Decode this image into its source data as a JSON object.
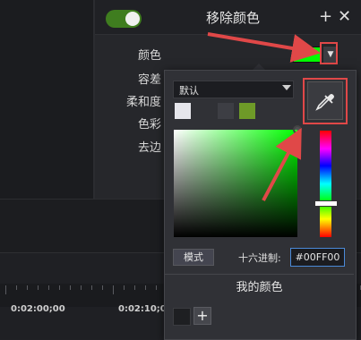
{
  "header": {
    "title": "移除颜色",
    "add_symbol": "+",
    "close_symbol": "✕"
  },
  "properties": {
    "color_label": "颜色",
    "tolerance_label": "容差",
    "softness_label": "柔和度",
    "hue_label": "色彩",
    "defringe_label": "去边",
    "selected_color": "#00ff00",
    "effect_enabled": true
  },
  "color_picker": {
    "preset": "默认",
    "recent_colors": [
      "#e6e6ec",
      "#3d3e44",
      "#6e9a28"
    ],
    "mode_label": "模式",
    "hex_label": "十六进制:",
    "hex_value": "#00FF00",
    "my_colors_title": "我的颜色",
    "my_colors": [
      "#1e1f22"
    ],
    "add_color_symbol": "+"
  },
  "timeline": {
    "time_labels": [
      "0:02:00;00",
      "0:02:10;00"
    ]
  },
  "colors": {
    "accent_red": "#e04848",
    "toggle_green": "#3f7d1f",
    "hex_focus_blue": "#4b8ad8"
  }
}
